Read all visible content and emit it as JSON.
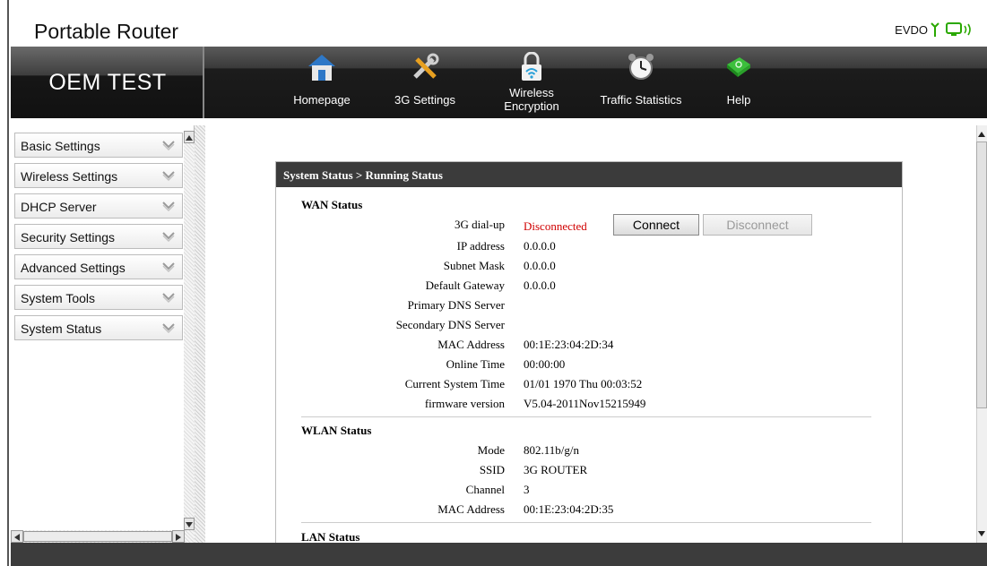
{
  "header": {
    "title": "Portable Router",
    "network_type": "EVDO",
    "brand": "OEM TEST"
  },
  "nav": {
    "items": [
      {
        "label": "Homepage",
        "icon": "home-icon"
      },
      {
        "label": "3G Settings",
        "icon": "tools-icon"
      },
      {
        "label_line1": "Wireless",
        "label_line2": "Encryption",
        "icon": "wireless-lock-icon"
      },
      {
        "label": "Traffic Statistics",
        "icon": "alarm-clock-icon"
      },
      {
        "label": "Help",
        "icon": "help-book-icon"
      }
    ]
  },
  "sidebar": {
    "items": [
      {
        "label": "Basic Settings"
      },
      {
        "label": "Wireless Settings"
      },
      {
        "label": "DHCP Server"
      },
      {
        "label": "Security Settings"
      },
      {
        "label": "Advanced Settings"
      },
      {
        "label": "System Tools"
      },
      {
        "label": "System Status"
      }
    ]
  },
  "panel": {
    "header": "System Status > Running Status",
    "wan": {
      "title": "WAN Status",
      "dialup_label": "3G dial-up",
      "dialup_value": "Disconnected",
      "connect_label": "Connect",
      "disconnect_label": "Disconnect",
      "rows": [
        {
          "label": "IP address",
          "value": "0.0.0.0"
        },
        {
          "label": "Subnet Mask",
          "value": "0.0.0.0"
        },
        {
          "label": "Default Gateway",
          "value": "0.0.0.0"
        },
        {
          "label": "Primary DNS Server",
          "value": ""
        },
        {
          "label": "Secondary DNS Server",
          "value": ""
        },
        {
          "label": "MAC Address",
          "value": "00:1E:23:04:2D:34"
        },
        {
          "label": "Online Time",
          "value": "00:00:00"
        },
        {
          "label": "Current System Time",
          "value": "01/01 1970 Thu 00:03:52"
        },
        {
          "label": "firmware version",
          "value": "V5.04-2011Nov15215949"
        }
      ]
    },
    "wlan": {
      "title": "WLAN Status",
      "rows": [
        {
          "label": "Mode",
          "value": "802.11b/g/n"
        },
        {
          "label": "SSID",
          "value": "3G ROUTER"
        },
        {
          "label": "Channel",
          "value": "3"
        },
        {
          "label": "MAC Address",
          "value": "00:1E:23:04:2D:35"
        }
      ]
    },
    "lan": {
      "title": "LAN Status"
    }
  },
  "colors": {
    "header_dark": "#3b3b3b",
    "status_disconnected": "#d00000",
    "signal_green": "#2aa800"
  }
}
